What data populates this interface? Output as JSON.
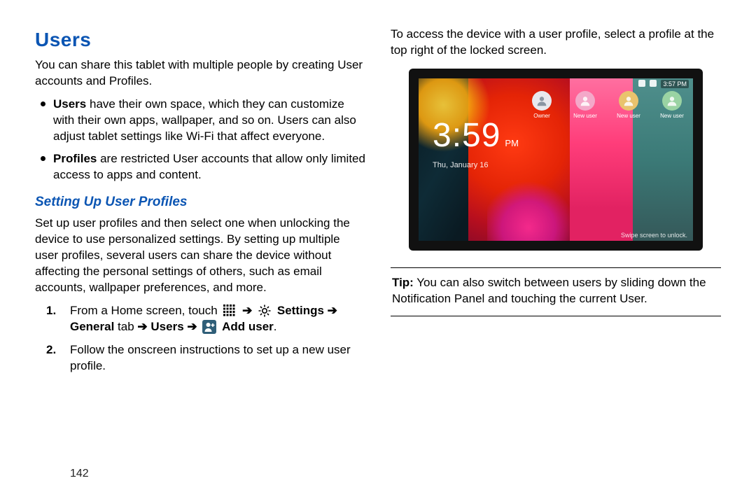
{
  "heading": "Users",
  "intro": "You can share this tablet with multiple people by creating User accounts and Profiles.",
  "bullets": {
    "b1_bold": "Users",
    "b1_rest": " have their own space, which they can customize with their own apps, wallpaper, and so on. Users can also adjust tablet settings like Wi-Fi that affect everyone.",
    "b2_bold": "Profiles",
    "b2_rest": " are restricted User accounts that allow only limited access to apps and content."
  },
  "subheading": "Setting Up User Profiles",
  "setup_para": "Set up user profiles and then select one when unlocking the device to use personalized settings. By setting up multiple user profiles, several users can share the device without affecting the personal settings of others, such as email accounts, wallpaper preferences, and more.",
  "step1": {
    "pre": "From a Home screen, touch ",
    "arrow1": "➔",
    "settings": "Settings",
    "arrow2": "➔",
    "general": "General",
    "tab": " tab ",
    "arrow3": "➔",
    "users": "Users",
    "arrow4": "➔",
    "adduser": "Add user",
    "period": "."
  },
  "step2": "Follow the onscreen instructions to set up a new user profile.",
  "right_intro": "To access the device with a user profile, select a profile at the top right of the locked screen.",
  "tablet": {
    "status_time": "3:57 PM",
    "time": "3:59",
    "ampm": "PM",
    "date": "Thu, January 16",
    "swipe": "Swipe screen to unlock.",
    "owner": "Owner",
    "newuser": "New user"
  },
  "tip_label": "Tip:",
  "tip_text": " You can also switch between users by sliding down the Notification Panel and touching the current User.",
  "page_number": "142"
}
